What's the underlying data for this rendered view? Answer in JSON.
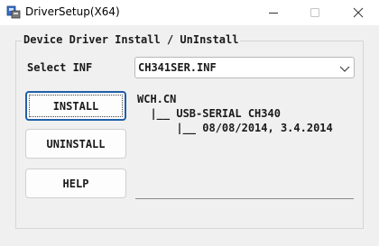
{
  "window": {
    "title": "DriverSetup(X64)",
    "controls": {
      "minimize": "—",
      "maximize": "☐",
      "close": "✕"
    }
  },
  "group": {
    "label": "Device Driver Install / UnInstall"
  },
  "inf": {
    "label": "Select INF",
    "selected": "CH341SER.INF"
  },
  "buttons": {
    "install": "INSTALL",
    "uninstall": "UNINSTALL",
    "help": "HELP"
  },
  "info": {
    "lines": [
      "WCH.CN",
      "  |__ USB-SERIAL CH340",
      "      |__ 08/08/2014, 3.4.2014"
    ]
  },
  "icons": {
    "app": "driver-setup-icon",
    "dropdown": "chevron-down-icon"
  },
  "colors": {
    "focus_border": "#1f5fa8",
    "background": "#f0f0f0"
  }
}
